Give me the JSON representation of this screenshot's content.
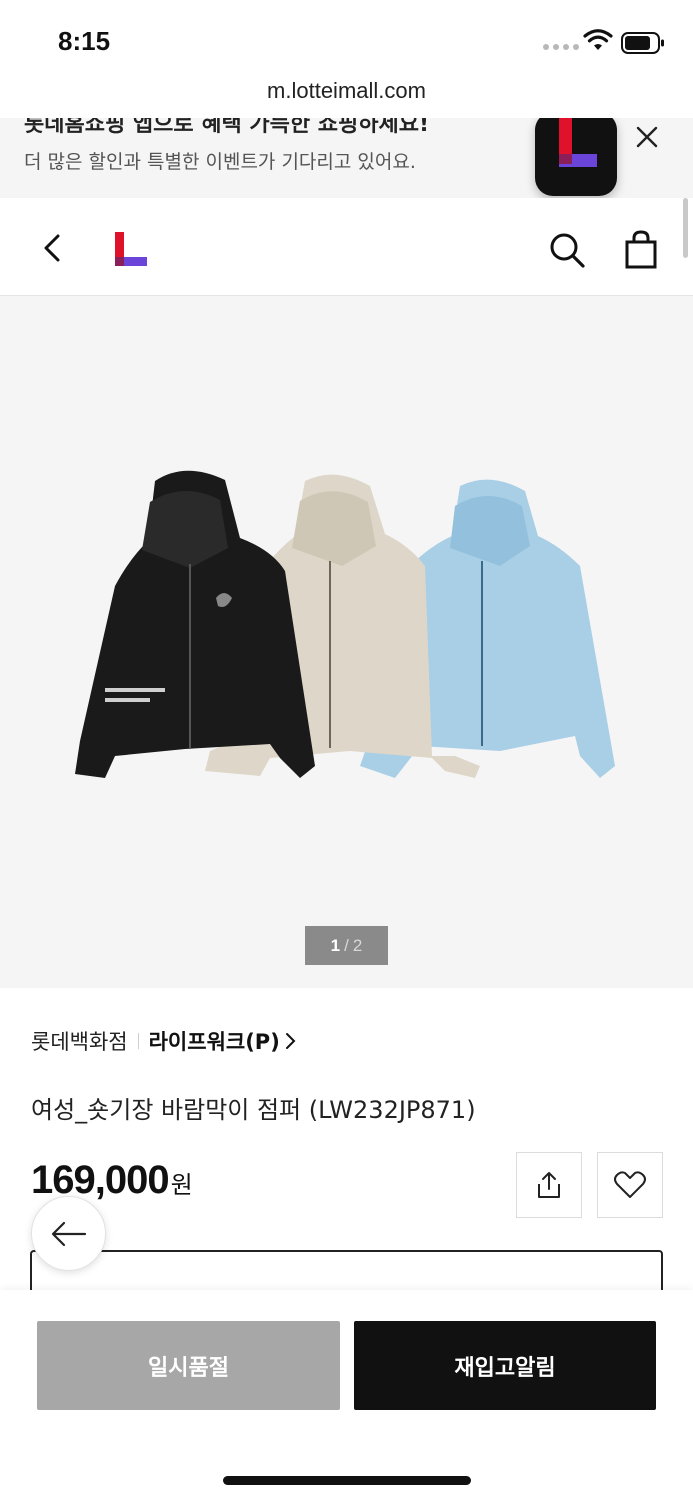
{
  "status_bar": {
    "time": "8:15"
  },
  "url_bar": {
    "url": "m.lotteimall.com"
  },
  "app_banner": {
    "title": "롯데홈쇼핑 앱으로 혜택 가득한 쇼핑하세요!",
    "subtitle": "더 많은 할인과 특별한 이벤트가 기다리고 있어요."
  },
  "product": {
    "image_counter": {
      "current": "1",
      "separator": "/",
      "total": "2"
    },
    "store": "롯데백화점",
    "brand": "라이프워크(P)",
    "title": "여성_숏기장 바람막이 점퍼 (LW232JP871)",
    "price": "169,000",
    "price_unit": "원"
  },
  "actions": {
    "soldout_label": "일시품절",
    "restock_label": "재입고알림"
  },
  "colors": {
    "accent_red": "#e0112b",
    "accent_purple": "#6b44d9",
    "soldout_gray": "#a7a7a7",
    "dark": "#111111"
  },
  "icons": [
    "back-icon",
    "search-icon",
    "shopping-bag-icon",
    "close-icon",
    "share-icon",
    "heart-icon",
    "arrow-left-icon",
    "wifi-icon",
    "battery-icon"
  ]
}
